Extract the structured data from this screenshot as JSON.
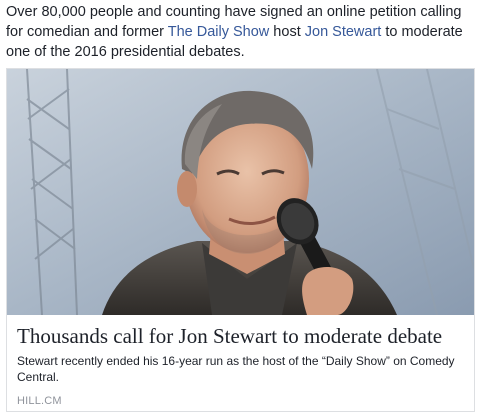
{
  "post": {
    "text_before": "Over 80,000 people and counting have signed an online petition calling for comedian and former ",
    "link_show": "The Daily Show",
    "text_middle": " host ",
    "link_person": "Jon Stewart",
    "text_after": " to moderate one of the 2016 presidential debates."
  },
  "card": {
    "title": "Thousands call for Jon Stewart to moderate debate",
    "description": "Stewart recently ended his 16-year run as the host of the “Daily Show” on Comedy Central.",
    "source": "HILL.CM"
  },
  "colors": {
    "link": "#365899",
    "text": "#1d2129",
    "muted": "#90949c",
    "border": "#dddfe2"
  }
}
